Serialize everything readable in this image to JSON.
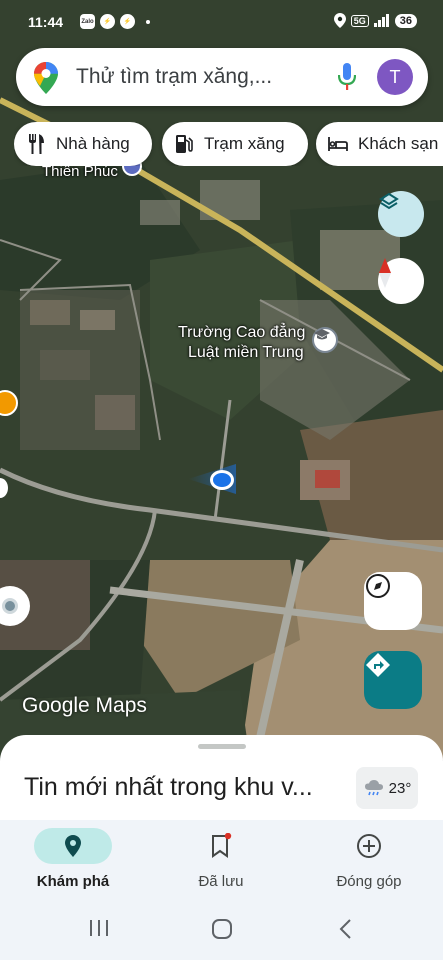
{
  "status_bar": {
    "time": "11:44",
    "app_icons": [
      "zalo-icon",
      "messenger-icon",
      "messenger-icon",
      "dot"
    ],
    "network": "5G",
    "battery": "36"
  },
  "search": {
    "placeholder": "Thử tìm trạm xăng,...",
    "avatar_letter": "T"
  },
  "chips": [
    {
      "label": "Nhà hàng",
      "icon": "restaurant-icon"
    },
    {
      "label": "Trạm xăng",
      "icon": "gas-station-icon"
    },
    {
      "label": "Khách sạn",
      "icon": "hotel-icon"
    }
  ],
  "map": {
    "labels": {
      "thien_phuc": "Thiên Phúc",
      "college_line1": "Trường Cao đẳng",
      "college_line2": "Luật miền Trung"
    },
    "watermark": "Google Maps"
  },
  "sheet": {
    "news_title": "Tin mới nhất trong khu v...",
    "weather_temp": "23°"
  },
  "bottom_nav": [
    {
      "label": "Khám phá",
      "icon": "explore-pin-icon",
      "active": true
    },
    {
      "label": "Đã lưu",
      "icon": "bookmark-icon",
      "active": false
    },
    {
      "label": "Đóng góp",
      "icon": "add-circle-icon",
      "active": false
    }
  ],
  "colors": {
    "accent_teal": "#0b7c86",
    "avatar": "#7e57c2",
    "active_nav_bg": "#bfeae8",
    "compass_red": "#d93025",
    "location_dot": "#1a73e8"
  }
}
